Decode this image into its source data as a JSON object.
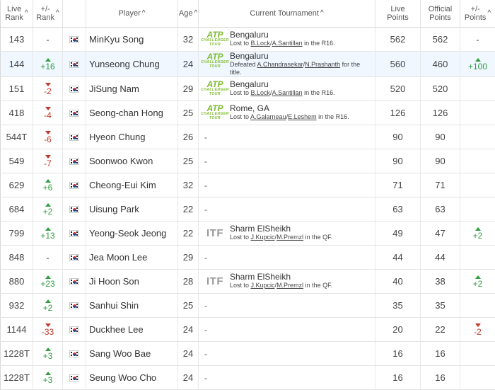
{
  "headers": {
    "live_rank": [
      "Live",
      "Rank"
    ],
    "rank_change": [
      "+/-",
      "Rank"
    ],
    "player": "Player",
    "age": "Age",
    "tournament": "Current Tournament",
    "live_points": [
      "Live",
      "Points"
    ],
    "official_points": [
      "Official",
      "Points"
    ],
    "points_change": [
      "+/-",
      "Points"
    ],
    "sort_glyph": "^"
  },
  "colors": {
    "up": "#2e9e3e",
    "down": "#c0392b",
    "atp_logo": "#7dbb2b",
    "highlight_row": "#f0f7ff"
  },
  "rows": [
    {
      "rank": "143",
      "change": "-",
      "dir": "none",
      "player": "MinKyu Song",
      "age": "32",
      "logo": "atp",
      "tournament": "Bengaluru",
      "result_pre": "Lost to ",
      "p1": "B.Lock",
      "sep": "/",
      "p2": "A.Santillan",
      "result_post": " in the R16.",
      "live_points": "562",
      "official_points": "562",
      "pts_change": "-",
      "pts_dir": "none"
    },
    {
      "rank": "144",
      "change": "+16",
      "dir": "up",
      "player": "Yunseong Chung",
      "age": "24",
      "logo": "atp",
      "tournament": "Bengaluru",
      "result_pre": "Defeated ",
      "p1": "A.Chandrasekar",
      "sep": "/",
      "p2": "N.Prashanth",
      "result_post": " for the title.",
      "live_points": "560",
      "official_points": "460",
      "pts_change": "+100",
      "pts_dir": "up",
      "highlight": true
    },
    {
      "rank": "151",
      "change": "-2",
      "dir": "down",
      "player": "JiSung Nam",
      "age": "29",
      "logo": "atp",
      "tournament": "Bengaluru",
      "result_pre": "Lost to ",
      "p1": "B.Lock",
      "sep": "/",
      "p2": "A.Santillan",
      "result_post": " in the R16.",
      "live_points": "520",
      "official_points": "520",
      "pts_change": "",
      "pts_dir": "none"
    },
    {
      "rank": "418",
      "change": "-4",
      "dir": "down",
      "player": "Seong-chan Hong",
      "age": "25",
      "logo": "atp",
      "tournament": "Rome, GA",
      "result_pre": "Lost to ",
      "p1": "A.Galarneau",
      "sep": "/",
      "p2": "E.Leshem",
      "result_post": " in the R16.",
      "live_points": "126",
      "official_points": "126",
      "pts_change": "",
      "pts_dir": "none"
    },
    {
      "rank": "544T",
      "change": "-6",
      "dir": "down",
      "player": "Hyeon Chung",
      "age": "26",
      "logo": "none",
      "tournament": "-",
      "live_points": "90",
      "official_points": "90",
      "pts_change": "",
      "pts_dir": "none"
    },
    {
      "rank": "549",
      "change": "-7",
      "dir": "down",
      "player": "Soonwoo Kwon",
      "age": "25",
      "logo": "none",
      "tournament": "-",
      "live_points": "90",
      "official_points": "90",
      "pts_change": "",
      "pts_dir": "none"
    },
    {
      "rank": "629",
      "change": "+6",
      "dir": "up",
      "player": "Cheong-Eui Kim",
      "age": "32",
      "logo": "none",
      "tournament": "-",
      "live_points": "71",
      "official_points": "71",
      "pts_change": "",
      "pts_dir": "none"
    },
    {
      "rank": "684",
      "change": "+2",
      "dir": "up",
      "player": "Uisung Park",
      "age": "22",
      "logo": "none",
      "tournament": "-",
      "live_points": "63",
      "official_points": "63",
      "pts_change": "",
      "pts_dir": "none"
    },
    {
      "rank": "799",
      "change": "+13",
      "dir": "up",
      "player": "Yeong-Seok Jeong",
      "age": "22",
      "logo": "itf",
      "tournament": "Sharm ElSheikh",
      "result_pre": "Lost to ",
      "p1": "J.Kupcic",
      "sep": "/",
      "p2": "M.Premzl",
      "result_post": " in the QF.",
      "live_points": "49",
      "official_points": "47",
      "pts_change": "+2",
      "pts_dir": "up"
    },
    {
      "rank": "848",
      "change": "-",
      "dir": "none",
      "player": "Jea Moon Lee",
      "age": "29",
      "logo": "none",
      "tournament": "-",
      "live_points": "44",
      "official_points": "44",
      "pts_change": "",
      "pts_dir": "none"
    },
    {
      "rank": "880",
      "change": "+23",
      "dir": "up",
      "player": "Ji Hoon Son",
      "age": "28",
      "logo": "itf",
      "tournament": "Sharm ElSheikh",
      "result_pre": "Lost to ",
      "p1": "J.Kupcic",
      "sep": "/",
      "p2": "M.Premzl",
      "result_post": " in the QF.",
      "live_points": "40",
      "official_points": "38",
      "pts_change": "+2",
      "pts_dir": "up"
    },
    {
      "rank": "932",
      "change": "+2",
      "dir": "up",
      "player": "Sanhui Shin",
      "age": "25",
      "logo": "none",
      "tournament": "-",
      "live_points": "35",
      "official_points": "35",
      "pts_change": "",
      "pts_dir": "none"
    },
    {
      "rank": "1144",
      "change": "-33",
      "dir": "down",
      "player": "Duckhee Lee",
      "age": "24",
      "logo": "none",
      "tournament": "-",
      "live_points": "20",
      "official_points": "22",
      "pts_change": "-2",
      "pts_dir": "down"
    },
    {
      "rank": "1228T",
      "change": "+3",
      "dir": "up",
      "player": "Sang Woo Bae",
      "age": "24",
      "logo": "none",
      "tournament": "-",
      "live_points": "16",
      "official_points": "16",
      "pts_change": "",
      "pts_dir": "none"
    },
    {
      "rank": "1228T",
      "change": "+3",
      "dir": "up",
      "player": "Seung Woo Cho",
      "age": "24",
      "logo": "none",
      "tournament": "-",
      "live_points": "16",
      "official_points": "16",
      "pts_change": "",
      "pts_dir": "none"
    }
  ],
  "logos": {
    "atp_text": "ATP",
    "atp_sub": "CHALLENGER TOUR",
    "itf_text": "ITF"
  }
}
